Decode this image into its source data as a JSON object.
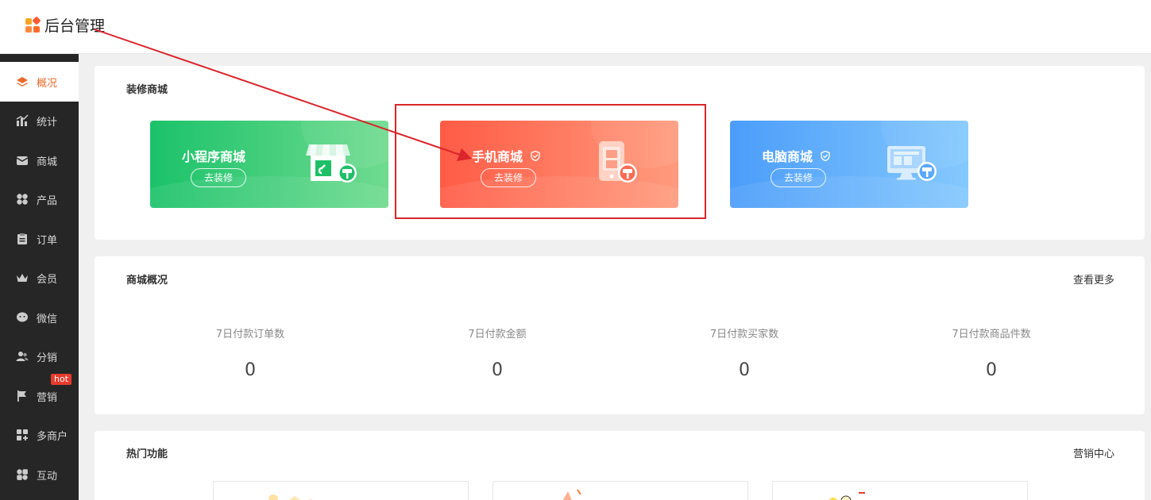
{
  "app": {
    "title": "后台管理"
  },
  "sidebar": {
    "items": [
      {
        "label": "概况",
        "icon": "layers-icon"
      },
      {
        "label": "统计",
        "icon": "chart-icon"
      },
      {
        "label": "商城",
        "icon": "mail-icon"
      },
      {
        "label": "产品",
        "icon": "grid-icon"
      },
      {
        "label": "订单",
        "icon": "clipboard-icon"
      },
      {
        "label": "会员",
        "icon": "crown-icon"
      },
      {
        "label": "微信",
        "icon": "chat-icon"
      },
      {
        "label": "分销",
        "icon": "users-icon"
      },
      {
        "label": "营销",
        "icon": "flag-icon"
      },
      {
        "label": "多商户",
        "icon": "store-plus-icon"
      },
      {
        "label": "互动",
        "icon": "apps-icon"
      }
    ],
    "hot_badge": "hot",
    "active_color": "#e86c2c"
  },
  "decorate": {
    "title": "装修商城",
    "cards": [
      {
        "name": "小程序商城",
        "button": "去装修",
        "color": "#1bc26a"
      },
      {
        "name": "手机商城",
        "button": "去装修",
        "color": "#ff5b45"
      },
      {
        "name": "电脑商城",
        "button": "去装修",
        "color": "#4b9dfa"
      }
    ]
  },
  "overview": {
    "title": "商城概况",
    "more_link": "查看更多",
    "stats": [
      {
        "label": "7日付款订单数",
        "value": "0"
      },
      {
        "label": "7日付款金额",
        "value": "0"
      },
      {
        "label": "7日付款买家数",
        "value": "0"
      },
      {
        "label": "7日付款商品件数",
        "value": "0"
      }
    ]
  },
  "hot_features": {
    "title": "热门功能",
    "more_link": "营销中心"
  },
  "annotation_color": "#d9252b"
}
